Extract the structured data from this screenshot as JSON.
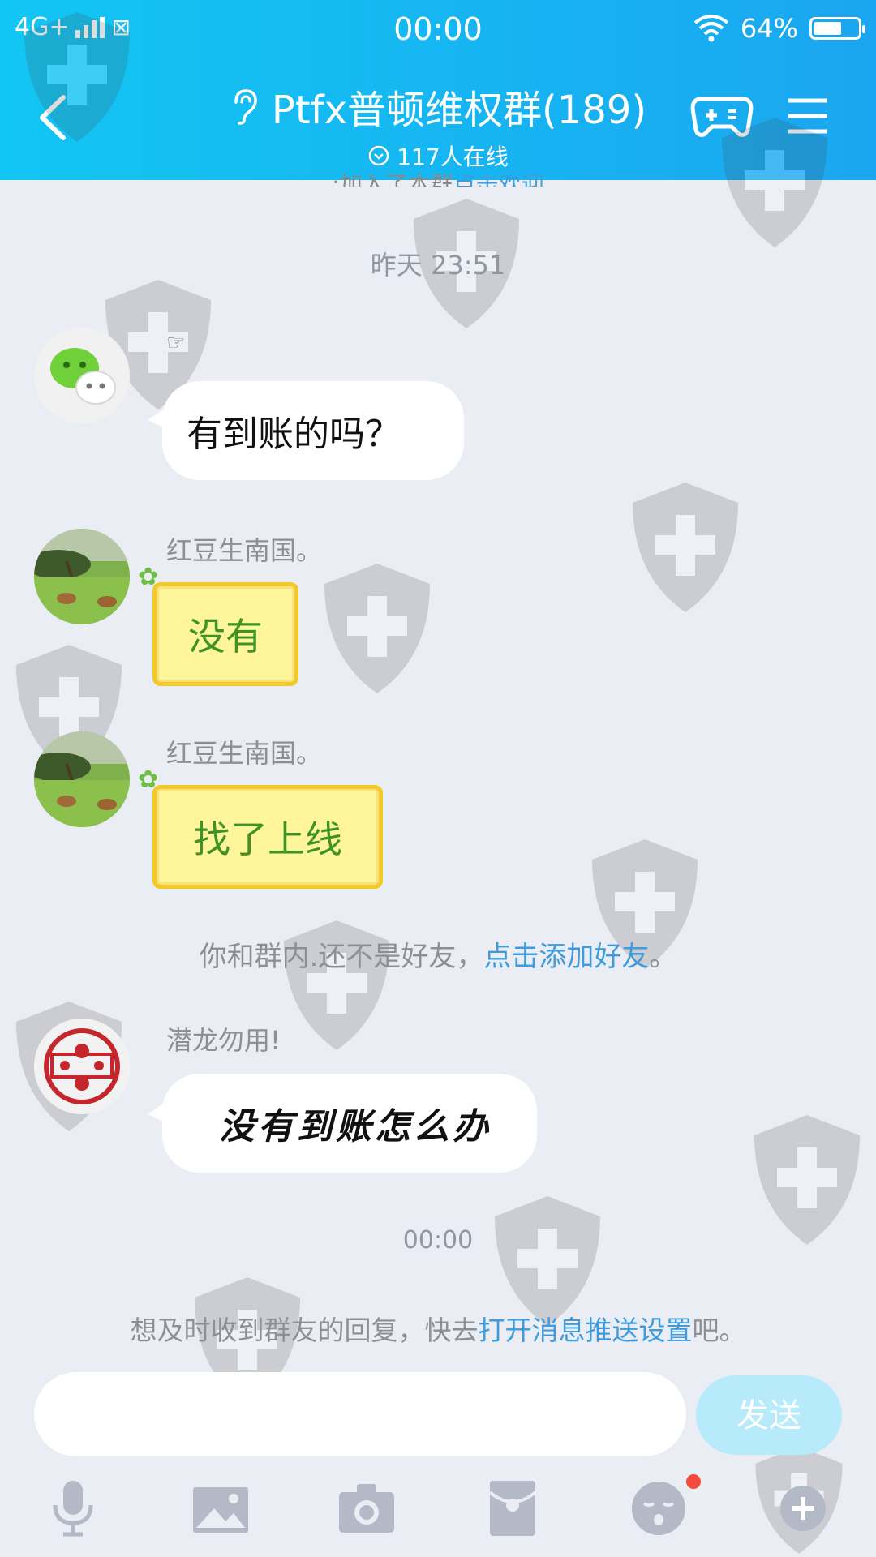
{
  "status_bar": {
    "network": "4G+",
    "time": "00:00",
    "battery_percent": "64%",
    "battery_level": 0.64
  },
  "header": {
    "title": "Ptfx普顿维权群(189)",
    "online": "117人在线",
    "icons": [
      "back-icon",
      "ear-icon",
      "online-check-icon",
      "gamepad-icon",
      "menu-icon"
    ]
  },
  "chat": {
    "cut_notice_prefix": ":加入了本群",
    "cut_notice_link": "点击欢迎",
    "timestamp_1": "昨天 23:51",
    "msg1_badge": "☞",
    "msg1_text": "有到账的吗？",
    "msg2_sender": "红豆生南国。",
    "msg2_text": "没有",
    "msg3_sender": "红豆生南国。",
    "msg3_text": "找了上线",
    "friend_notice_prefix": "你和群内.还不是好友，",
    "friend_notice_link": "点击添加好友",
    "friend_notice_suffix": "。",
    "msg4_sender": "潜龙勿用!",
    "msg4_text": "没有到账怎么办",
    "avatar4_stamp": "梁印能惠",
    "timestamp_2": "00:00",
    "push_notice_prefix": "想及时收到群友的回复，快去",
    "push_notice_link": "打开消息推送设置",
    "push_notice_suffix": "吧。"
  },
  "input": {
    "placeholder": "",
    "send_label": "发送"
  },
  "toolbar": {
    "items": [
      "microphone-icon",
      "image-icon",
      "camera-icon",
      "red-packet-icon",
      "emoji-icon",
      "plus-icon"
    ]
  },
  "colors": {
    "header_gradient_start": "#12c6f3",
    "header_gradient_end": "#1aa6f0",
    "chat_background": "#eaedf3",
    "link": "#3f9bdc",
    "yellow_bubble": "#fff59a",
    "yellow_bubble_text": "#3f9224",
    "send_button": "#b7eafb"
  }
}
